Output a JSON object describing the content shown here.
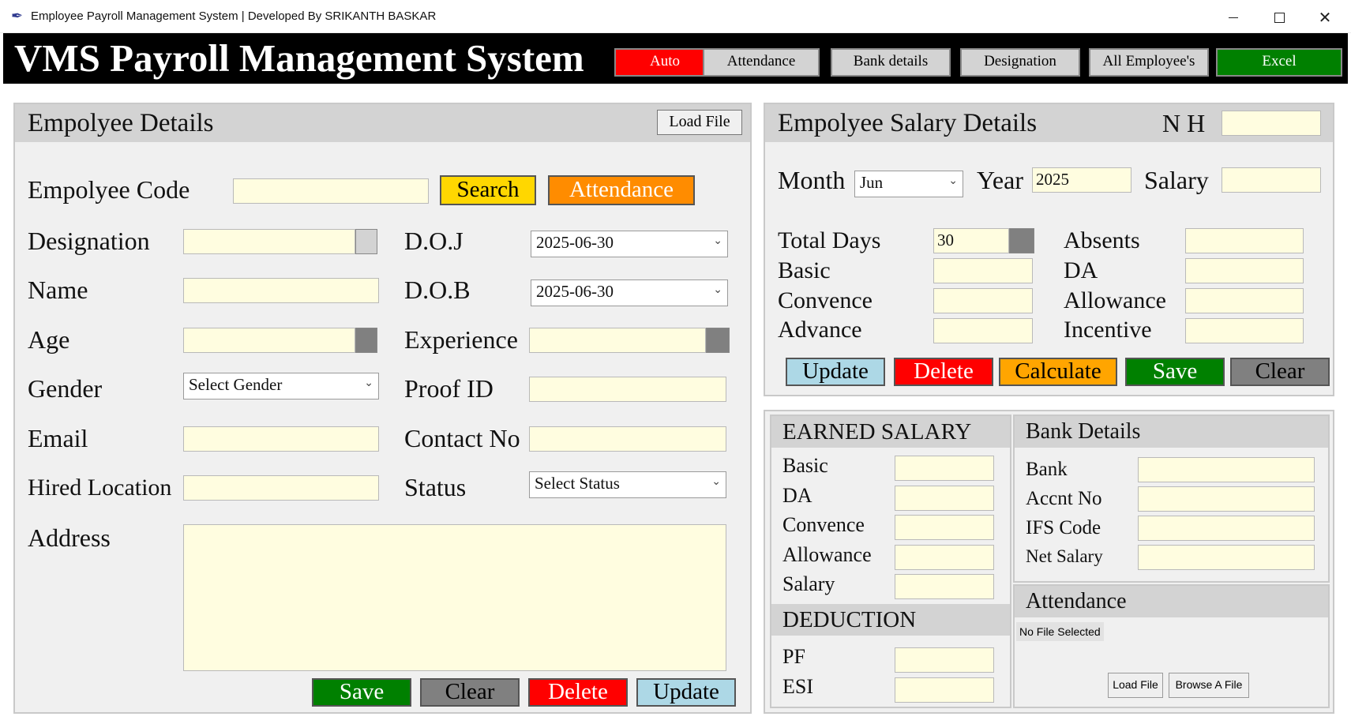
{
  "window": {
    "title": "Employee Payroll Management System | Developed By SRIKANTH BASKAR",
    "app_icon": "feather-icon",
    "minimize_icon": "minimize-icon",
    "maximize_icon": "maximize-icon",
    "close_icon": "close-icon"
  },
  "header": {
    "title": "VMS Payroll Management System",
    "buttons": [
      {
        "label": "Auto",
        "color": "#ff0000",
        "text_color": "#ffffff"
      },
      {
        "label": "Attendance",
        "color": "#d3d3d3",
        "text_color": "#000000"
      },
      {
        "label": "Bank details",
        "color": "#d3d3d3",
        "text_color": "#000000"
      },
      {
        "label": "Designation",
        "color": "#d3d3d3",
        "text_color": "#000000"
      },
      {
        "label": "All Employee's",
        "color": "#d3d3d3",
        "text_color": "#000000"
      },
      {
        "label": "Excel",
        "color": "#008000",
        "text_color": "#ffffff"
      }
    ]
  },
  "employee_details": {
    "title": "Empolyee Details",
    "load_file": "Load File",
    "code_label": "Empolyee Code",
    "code_value": "",
    "search": "Search",
    "attendance": "Attendance",
    "designation_label": "Designation",
    "designation_value": "",
    "doj_label": "D.O.J",
    "doj_value": "2025-06-30",
    "name_label": "Name",
    "name_value": "",
    "dob_label": "D.O.B",
    "dob_value": "2025-06-30",
    "age_label": "Age",
    "age_value": "",
    "experience_label": "Experience",
    "experience_value": "",
    "gender_label": "Gender",
    "gender_value": "Select Gender",
    "proof_label": "Proof ID",
    "proof_value": "",
    "email_label": "Email",
    "email_value": "",
    "contact_label": "Contact No",
    "contact_value": "",
    "location_label": "Hired Location",
    "location_value": "",
    "status_label": "Status",
    "status_value": "Select Status",
    "address_label": "Address",
    "address_value": "",
    "save": "Save",
    "clear": "Clear",
    "delete": "Delete",
    "update": "Update"
  },
  "salary_details": {
    "title": "Empolyee Salary Details",
    "nh_label": "N H",
    "nh_value": "",
    "month_label": "Month",
    "month_value": "Jun",
    "year_label": "Year",
    "year_value": "2025",
    "salary_label": "Salary",
    "salary_value": "",
    "total_days_label": "Total Days",
    "total_days_value": "30",
    "absents_label": "Absents",
    "absents_value": "",
    "basic_label": "Basic",
    "basic_value": "",
    "da_label": "DA",
    "da_value": "",
    "convence_label": "Convence",
    "convence_value": "",
    "allowance_label": "Allowance",
    "allowance_value": "",
    "advance_label": "Advance",
    "advance_value": "",
    "incentive_label": "Incentive",
    "incentive_value": "",
    "update": "Update",
    "delete": "Delete",
    "calculate": "Calculate",
    "save": "Save",
    "clear": "Clear"
  },
  "earned_salary": {
    "title": "EARNED SALARY",
    "basic_label": "Basic",
    "da_label": "DA",
    "convence_label": "Convence",
    "allowance_label": "Allowance",
    "salary_label": "Salary",
    "deduction_title": "DEDUCTION",
    "pf_label": "PF",
    "esi_label": "ESI"
  },
  "bank_details": {
    "title": "Bank Details",
    "bank_label": "Bank",
    "accnt_label": "Accnt No",
    "ifs_label": "IFS Code",
    "net_label": "Net Salary"
  },
  "attendance_panel": {
    "title": "Attendance",
    "file_status": "No File Selected",
    "load_file": "Load File",
    "browse": "Browse A File"
  },
  "colors": {
    "field_bg": "#fffde0",
    "panel_bg": "#f0f0f0",
    "panel_header": "#d3d3d3",
    "yellow": "#ffd700",
    "orange": "#ff8c00",
    "orange_light": "#ffa500",
    "red": "#ff0000",
    "green": "#008000",
    "gray": "#808080",
    "lightblue": "#add8e6"
  }
}
